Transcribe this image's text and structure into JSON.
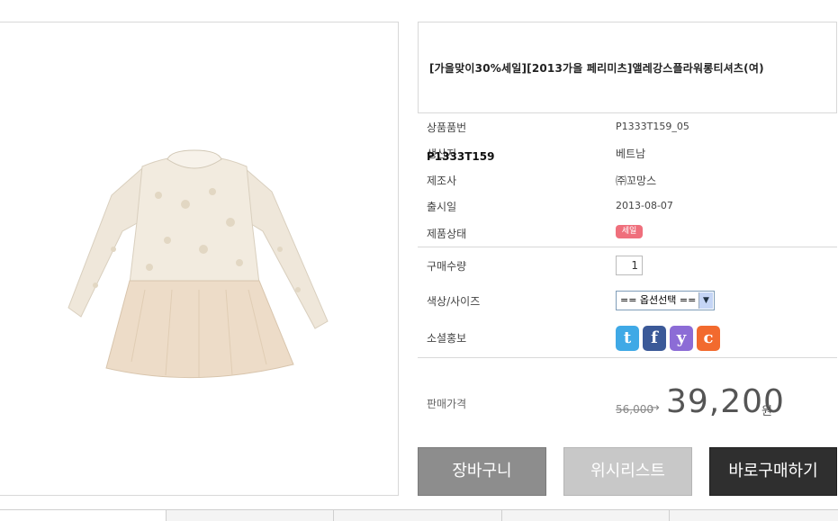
{
  "product": {
    "title": "[가을맞이30%세일][2013가을 페리미츠]앨레강스플라워롱티셔츠(여)",
    "overlay_code": "P1333T159",
    "image_icon": "dress-image"
  },
  "info": {
    "rows": [
      {
        "label": "상품품번",
        "value": "P1333T159_05"
      },
      {
        "label": "생산지",
        "value": "베트남"
      },
      {
        "label": "제조사",
        "value": "㈜꼬망스"
      },
      {
        "label": "출시일",
        "value": "2013-08-07"
      },
      {
        "label": "제품상태",
        "value": "세일"
      }
    ]
  },
  "purchase": {
    "qty_label": "구매수량",
    "qty_value": "1",
    "option_label": "색상/사이즈",
    "option_value": "== 옵션선택 ==",
    "social_label": "소셜홍보",
    "social_icons": [
      "twitter-icon",
      "facebook-icon",
      "yozm-icon",
      "cyworld-icon"
    ]
  },
  "price": {
    "label": "판매가격",
    "original": "56,000",
    "arrow": "→",
    "sale": "39,200",
    "unit": "원"
  },
  "buttons": {
    "cart": "장바구니",
    "wishlist": "위시리스트",
    "buy_now": "바로구매하기"
  },
  "colors": {
    "cart_button": "#8d8d8d",
    "wishlist_button": "#c8c8c8",
    "buy_button": "#2f2f2f",
    "sale_badge": "#ef6f7c"
  }
}
